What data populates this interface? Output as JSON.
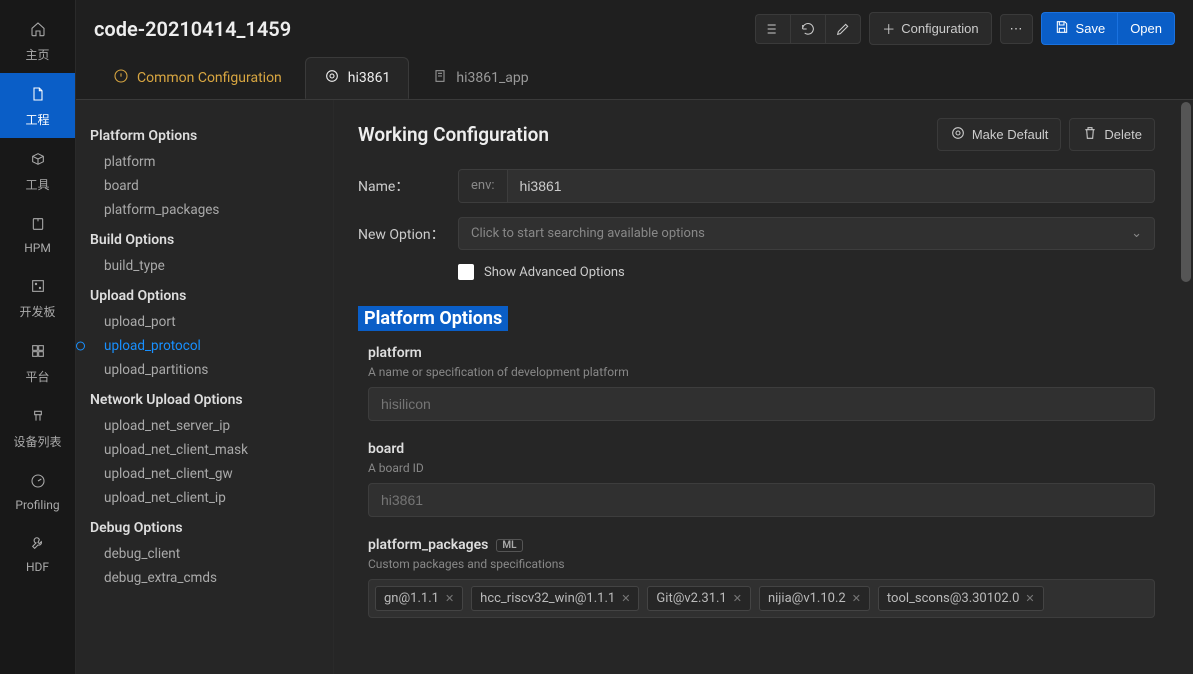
{
  "sidebar": {
    "items": [
      {
        "label": "主页",
        "icon": "home"
      },
      {
        "label": "工程",
        "icon": "file"
      },
      {
        "label": "工具",
        "icon": "box"
      },
      {
        "label": "HPM",
        "icon": "device"
      },
      {
        "label": "开发板",
        "icon": "board"
      },
      {
        "label": "平台",
        "icon": "grid"
      },
      {
        "label": "设备列表",
        "icon": "jig"
      },
      {
        "label": "Profiling",
        "icon": "gauge"
      },
      {
        "label": "HDF",
        "icon": "wrench"
      }
    ]
  },
  "project_title": "code-20210414_1459",
  "toolbar": {
    "configuration": "Configuration",
    "save": "Save",
    "open": "Open"
  },
  "tabs": [
    {
      "label": "Common Configuration",
      "icon": "warn"
    },
    {
      "label": "hi3861",
      "icon": "target"
    },
    {
      "label": "hi3861_app",
      "icon": "note"
    }
  ],
  "nav": {
    "groups": [
      {
        "title": "Platform Options",
        "items": [
          "platform",
          "board",
          "platform_packages"
        ]
      },
      {
        "title": "Build Options",
        "items": [
          "build_type"
        ]
      },
      {
        "title": "Upload Options",
        "items": [
          "upload_port",
          "upload_protocol",
          "upload_partitions"
        ]
      },
      {
        "title": "Network Upload Options",
        "items": [
          "upload_net_server_ip",
          "upload_net_client_mask",
          "upload_net_client_gw",
          "upload_net_client_ip"
        ]
      },
      {
        "title": "Debug Options",
        "items": [
          "debug_client",
          "debug_extra_cmds"
        ]
      }
    ],
    "selected": "upload_protocol"
  },
  "panel": {
    "heading": "Working Configuration",
    "make_default": "Make Default",
    "delete": "Delete",
    "name_label": "Name：",
    "name_prefix": "env:",
    "name_value": "hi3861",
    "new_option_label": "New Option：",
    "new_option_placeholder": "Click to start searching available options",
    "show_advanced": "Show Advanced Options",
    "section_platform": "Platform Options",
    "opts": {
      "platform": {
        "name": "platform",
        "desc": "A name or specification of development platform",
        "placeholder": "hisilicon"
      },
      "board": {
        "name": "board",
        "desc": "A board ID",
        "placeholder": "hi3861"
      },
      "platform_packages": {
        "name": "platform_packages",
        "badge": "ML",
        "desc": "Custom packages and specifications"
      }
    },
    "packages": [
      "gn@1.1.1",
      "hcc_riscv32_win@1.1.1",
      "Git@v2.31.1",
      "nijia@v1.10.2",
      "tool_scons@3.30102.0"
    ]
  }
}
